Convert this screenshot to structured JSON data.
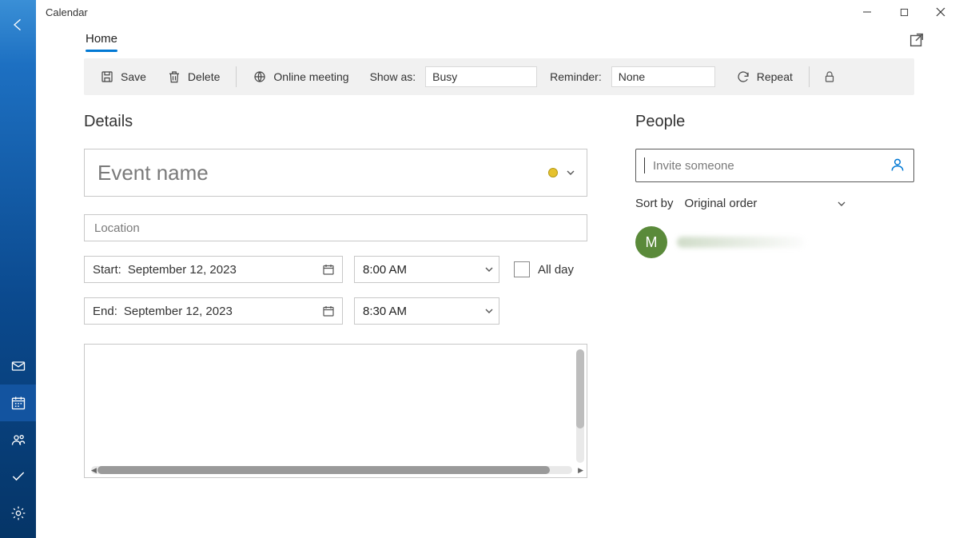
{
  "window": {
    "title": "Calendar"
  },
  "tabs": {
    "home": "Home"
  },
  "toolbar": {
    "save": "Save",
    "delete": "Delete",
    "online_meeting": "Online meeting",
    "show_as_label": "Show as:",
    "show_as_value": "Busy",
    "reminder_label": "Reminder:",
    "reminder_value": "None",
    "repeat": "Repeat"
  },
  "details": {
    "title": "Details",
    "event_name_placeholder": "Event name",
    "location_placeholder": "Location",
    "start_label": "Start:",
    "start_date": "September 12, 2023",
    "start_time": "8:00 AM",
    "end_label": "End:",
    "end_date": "September 12, 2023",
    "end_time": "8:30 AM",
    "all_day": "All day"
  },
  "people": {
    "title": "People",
    "invite_placeholder": "Invite someone",
    "sort_label": "Sort by",
    "sort_value": "Original order",
    "attendees": [
      {
        "initial": "M"
      }
    ]
  },
  "colors": {
    "category_dot": "#e6c22e",
    "avatar": "#5a8a3a",
    "accent": "#0078d4"
  }
}
